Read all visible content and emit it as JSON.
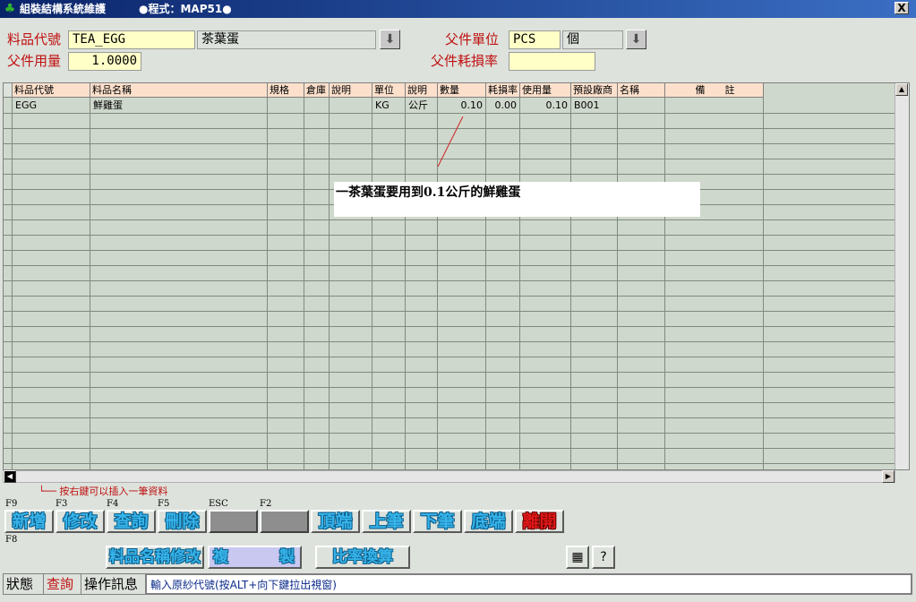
{
  "window": {
    "title": "組裝結構系統維護",
    "program": "●程式：MAP51●",
    "close": "X"
  },
  "form": {
    "item_code_label": "料品代號",
    "item_code": "TEA_EGG",
    "item_name": "茶葉蛋",
    "parent_unit_label": "父件單位",
    "parent_unit": "PCS",
    "parent_unit_name": "個",
    "parent_qty_label": "父件用量",
    "parent_qty": "1.0000",
    "parent_loss_label": "父件耗損率",
    "parent_loss": ""
  },
  "grid": {
    "columns": [
      "料品代號",
      "料品名稱",
      "規格",
      "倉庫",
      "說明",
      "單位",
      "說明",
      "數量",
      "耗損率",
      "使用量",
      "預設廠商",
      "名稱",
      "備　　註"
    ],
    "rows": [
      [
        "EGG",
        "鮮雞蛋",
        "",
        "",
        "",
        "KG",
        "公斤",
        "0.10",
        "0.00",
        "0.10",
        "B001",
        "",
        ""
      ]
    ]
  },
  "annotation": "一茶葉蛋要用到0.1公斤的鮮雞蛋",
  "hint": "└── 按右鍵可以插入一筆資料",
  "toolbar": {
    "keys": {
      "add": "F9",
      "edit": "F3",
      "query": "F4",
      "delete": "F5",
      "esc": "ESC",
      "f2": "F2",
      "f8": "F8"
    },
    "add": "新增",
    "edit": "修改",
    "query": "查詢",
    "delete": "刪除",
    "top": "頂端",
    "prev": "上筆",
    "next": "下筆",
    "bottom": "底端",
    "exit": "離開",
    "rename": "料品名稱修改",
    "copy_a": "複",
    "copy_b": "製",
    "ratio": "比率換算"
  },
  "status": {
    "label": "狀態",
    "mode": "查詢",
    "msg_label": "操作訊息",
    "message": "輸入原紗代號(按ALT+向下鍵拉出視窗)"
  }
}
